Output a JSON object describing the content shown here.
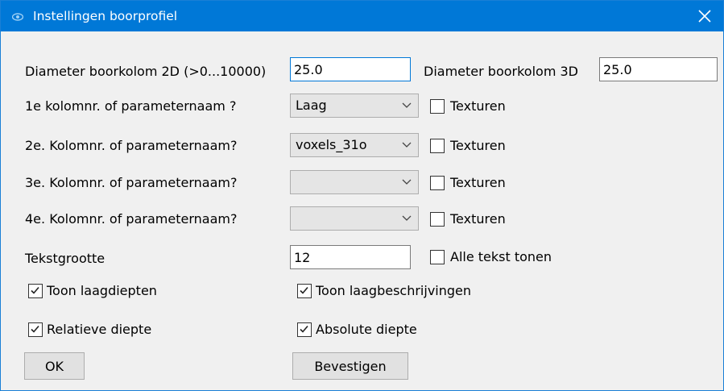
{
  "window": {
    "title": "Instellingen boorprofiel",
    "close_icon": "close-icon",
    "app_icon": "eye-icon"
  },
  "diameter2d": {
    "label": "Diameter boorkolom 2D  (>0...10000)",
    "value": "25.0"
  },
  "diameter3d": {
    "label": "Diameter boorkolom 3D",
    "value": "25.0"
  },
  "rows": [
    {
      "label": "1e kolomnr. of parameternaam ?",
      "selected": "Laag",
      "textures_label": "Texturen",
      "textures_checked": false
    },
    {
      "label": "2e. Kolomnr. of parameternaam?",
      "selected": "voxels_31o",
      "textures_label": "Texturen",
      "textures_checked": false
    },
    {
      "label": "3e. Kolomnr. of parameternaam?",
      "selected": "",
      "textures_label": "Texturen",
      "textures_checked": false
    },
    {
      "label": "4e. Kolomnr. of parameternaam?",
      "selected": "",
      "textures_label": "Texturen",
      "textures_checked": false
    }
  ],
  "text_size": {
    "label": "Tekstgrootte",
    "value": "12",
    "show_all_label": "Alle tekst tonen",
    "show_all_checked": false
  },
  "options": {
    "show_depths": {
      "label": "Toon laagdiepten",
      "checked": true
    },
    "show_descriptions": {
      "label": "Toon laagbeschrijvingen",
      "checked": true
    },
    "relative_depth": {
      "label": "Relatieve diepte",
      "checked": true
    },
    "absolute_depth": {
      "label": "Absolute diepte",
      "checked": true
    }
  },
  "buttons": {
    "ok": "OK",
    "confirm": "Bevestigen"
  }
}
